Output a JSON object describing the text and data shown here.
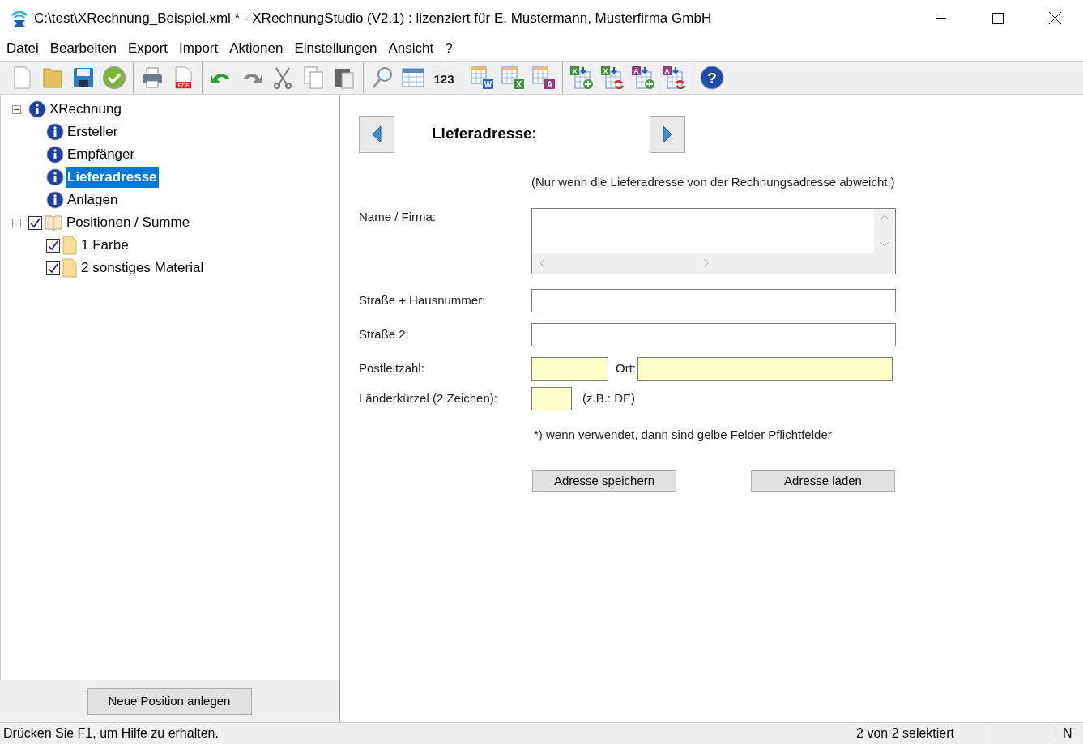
{
  "window": {
    "title": "C:\\test\\XRechnung_Beispiel.xml * - XRechnungStudio (V2.1) : lizenziert für E. Mustermann, Musterfirma GmbH"
  },
  "menu": [
    "Datei",
    "Bearbeiten",
    "Export",
    "Import",
    "Aktionen",
    "Einstellungen",
    "Ansicht",
    "?"
  ],
  "toolbar": [
    [
      {
        "kind": "new"
      },
      {
        "kind": "open"
      },
      {
        "kind": "save"
      },
      {
        "kind": "check"
      }
    ],
    [
      {
        "kind": "print"
      },
      {
        "kind": "pdf",
        "label": "PDF"
      }
    ],
    [
      {
        "kind": "undo"
      },
      {
        "kind": "redo"
      },
      {
        "kind": "cut"
      },
      {
        "kind": "copy"
      },
      {
        "kind": "paste"
      }
    ],
    [
      {
        "kind": "search"
      },
      {
        "kind": "table"
      },
      {
        "kind": "numbers",
        "label": "123"
      }
    ],
    [
      {
        "kind": "export",
        "label": "W",
        "color": "#2b6cc4"
      },
      {
        "kind": "export",
        "label": "X",
        "color": "#3f8f3f"
      },
      {
        "kind": "export",
        "label": "A",
        "color": "#9a3a7a"
      }
    ],
    [
      {
        "kind": "import-add",
        "label": "X",
        "color": "#3f8f3f"
      },
      {
        "kind": "import-sync",
        "label": "X",
        "color": "#3f8f3f"
      },
      {
        "kind": "import-add",
        "label": "A",
        "color": "#9a3a7a"
      },
      {
        "kind": "import-sync",
        "label": "A",
        "color": "#9a3a7a"
      }
    ],
    [
      {
        "kind": "help",
        "label": "?"
      }
    ]
  ],
  "tree": [
    {
      "label": "XRechnung",
      "kind": "info",
      "expanded": true,
      "selected": false,
      "children": [
        {
          "label": "Ersteller",
          "kind": "info",
          "selected": false
        },
        {
          "label": "Empfänger",
          "kind": "info",
          "selected": false
        },
        {
          "label": "Lieferadresse",
          "kind": "info",
          "selected": true
        },
        {
          "label": "Anlagen",
          "kind": "info",
          "selected": false
        }
      ]
    },
    {
      "label": "Positionen / Summe",
      "kind": "book",
      "checked": true,
      "expanded": true,
      "selected": false,
      "children": [
        {
          "label": "1 Farbe",
          "kind": "page",
          "checked": true,
          "selected": false
        },
        {
          "label": "2 sonstiges Material",
          "kind": "page",
          "checked": true,
          "selected": false
        }
      ]
    }
  ],
  "left_button": "Neue Position anlegen",
  "form": {
    "heading": "Lieferadresse:",
    "hint": "(Nur wenn die Lieferadresse von der Rechnungsadresse abweicht.)",
    "rows": [
      {
        "kind": "textarea",
        "label": "Name / Firma:",
        "required": false
      },
      {
        "kind": "text",
        "label": "Straße + Hausnummer:",
        "required": false
      },
      {
        "kind": "text",
        "label": "Straße 2:",
        "required": false
      },
      {
        "kind": "postal",
        "label": "Postleitzahl:",
        "required": true,
        "second_label": "Ort:",
        "second_required": true
      },
      {
        "kind": "country",
        "label": "Länderkürzel (2 Zeichen):",
        "required": true,
        "note": "(z.B.: DE)"
      }
    ],
    "footnote": "*) wenn verwendet, dann sind gelbe Felder Pflichtfelder",
    "buttons": [
      "Adresse speichern",
      "Adresse laden"
    ]
  },
  "status_bar": {
    "message": "Drücken Sie F1, um Hilfe zu erhalten.",
    "selection": "2 von 2 selektiert",
    "indicator": "N"
  }
}
